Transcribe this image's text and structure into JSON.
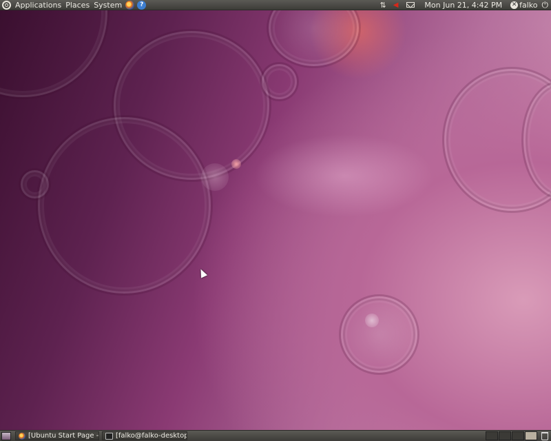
{
  "top_panel": {
    "menus": [
      "Applications",
      "Places",
      "System"
    ],
    "launchers": [
      "firefox-icon",
      "help-icon"
    ],
    "clock": "Mon Jun 21,  4:42 PM",
    "user": "falko",
    "tray_icons": [
      "network-icon",
      "volume-muted-icon",
      "mail-icon",
      "power-icon"
    ]
  },
  "bottom_panel": {
    "tasks": [
      {
        "label": "[Ubuntu Start Page - M...",
        "icon": "firefox-icon"
      },
      {
        "label": "[falko@falko-desktop: ~]",
        "icon": "terminal-icon"
      }
    ],
    "workspaces": 4,
    "active_workspace": 4
  },
  "colors": {
    "panel": "#46453f",
    "wallpaper_dark": "#3a0f2f",
    "wallpaper_light": "#d9a2bd"
  }
}
